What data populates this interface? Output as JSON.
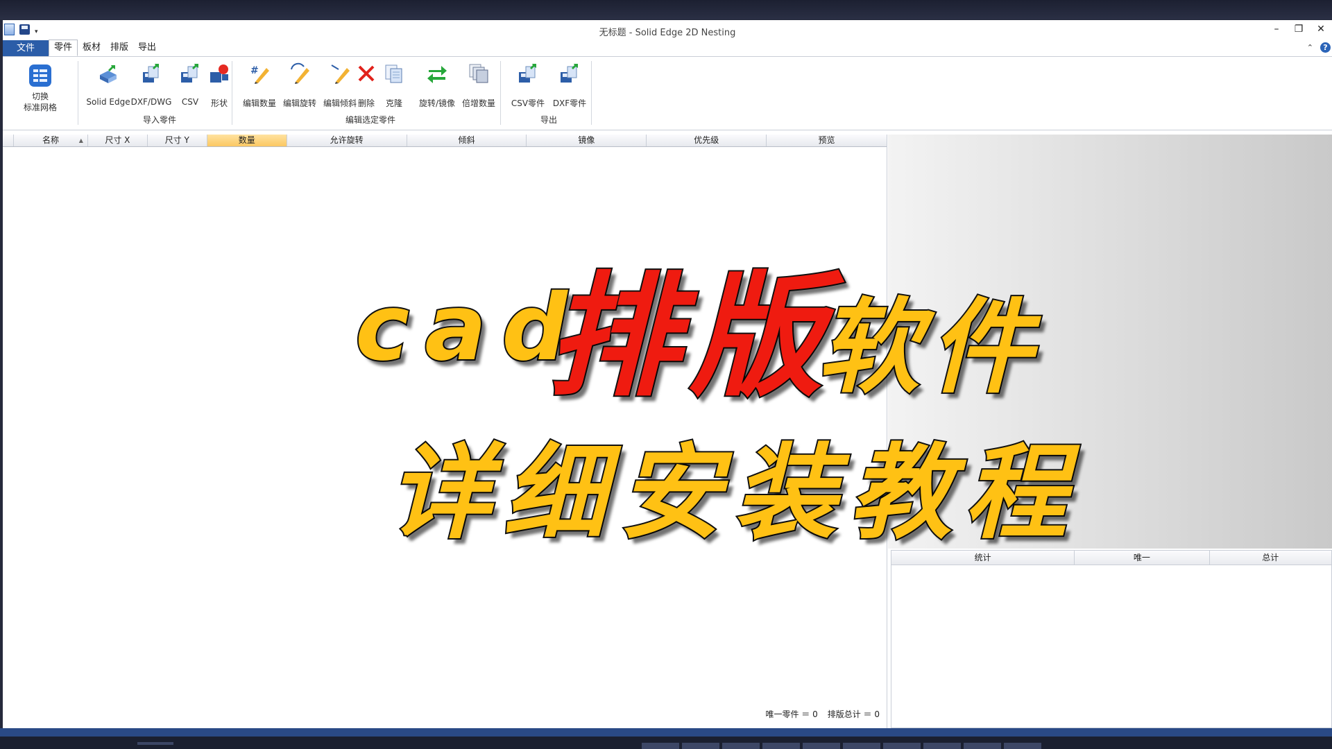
{
  "window": {
    "title": "无标题 - Solid Edge 2D Nesting",
    "controls": {
      "minimize": "–",
      "restore": "❐",
      "close": "✕"
    },
    "qat_arrow": "▾"
  },
  "tabs": {
    "file": "文件",
    "items": [
      "零件",
      "板材",
      "排版",
      "导出"
    ],
    "active": "零件",
    "collapse": "⌃",
    "help": "?"
  },
  "ribbon": {
    "grid_group": {
      "toggle_label": "切换\n标准网格",
      "icon": "grid-icon"
    },
    "import_group": {
      "label": "导入零件",
      "buttons": [
        {
          "label": "Solid Edge",
          "icon": "solid-edge-import-icon"
        },
        {
          "label": "DXF/DWG",
          "icon": "dxf-dwg-import-icon"
        },
        {
          "label": "CSV",
          "icon": "csv-import-icon"
        },
        {
          "label": "形状",
          "icon": "shape-icon"
        }
      ]
    },
    "edit_group": {
      "label": "编辑选定零件",
      "buttons": [
        {
          "label": "编辑数量",
          "icon": "edit-quantity-icon"
        },
        {
          "label": "编辑旋转",
          "icon": "edit-rotation-icon"
        },
        {
          "label": "编辑倾斜",
          "icon": "edit-tilt-icon"
        },
        {
          "label": "删除",
          "icon": "delete-icon"
        },
        {
          "label": "克隆",
          "icon": "clone-icon"
        },
        {
          "label": "旋转/镜像",
          "icon": "rotate-mirror-icon"
        },
        {
          "label": "倍增数量",
          "icon": "multiply-quantity-icon"
        }
      ]
    },
    "export_group": {
      "label": "导出",
      "buttons": [
        {
          "label": "CSV零件",
          "icon": "csv-export-icon"
        },
        {
          "label": "DXF零件",
          "icon": "dxf-export-icon"
        }
      ]
    }
  },
  "parts_grid": {
    "columns": [
      "名称",
      "尺寸 X",
      "尺寸 Y",
      "数量",
      "允许旋转",
      "倾斜",
      "镜像",
      "优先级",
      "预览"
    ],
    "sorted_column": "数量",
    "sort_arrow": "▲",
    "rows": [],
    "status": {
      "unique_parts": "唯一零件 ＝ 0",
      "nest_total": "排版总计 ＝ 0"
    }
  },
  "stats_panel": {
    "columns": [
      "统计",
      "唯一",
      "总计"
    ],
    "rows": []
  },
  "overlay": {
    "word_cad": "cad",
    "word_nesting": "排版",
    "word_software": "软件",
    "line2": "详细安装教程",
    "colors": {
      "yellow": "#ffc114",
      "red": "#ef1b10",
      "outline": "#111111"
    }
  },
  "colors": {
    "file_tab": "#2b5da8",
    "sorted_header": "#fbc862",
    "taskbar": "#2a4a86"
  }
}
